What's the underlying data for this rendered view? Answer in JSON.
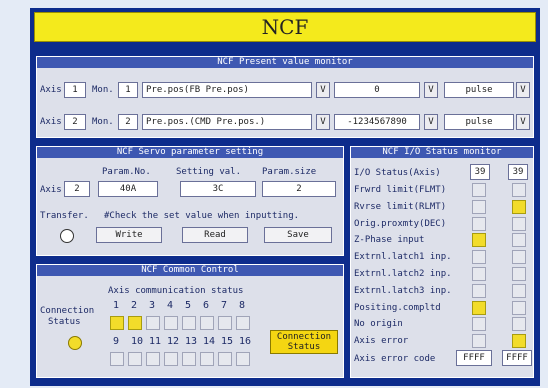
{
  "title": "NCF",
  "present_value": {
    "header": "NCF Present value monitor",
    "rows": [
      {
        "axis_label": "Axis",
        "axis": "1",
        "mon_label": "Mon.",
        "mon": "1",
        "desc": "Pre.pos(FB Pre.pos)",
        "value": "0",
        "unit": "pulse",
        "v": "V"
      },
      {
        "axis_label": "Axis",
        "axis": "2",
        "mon_label": "Mon.",
        "mon": "2",
        "desc": "Pre.pos.(CMD Pre.pos.)",
        "value": "-1234567890",
        "unit": "pulse",
        "v": "V"
      }
    ]
  },
  "servo": {
    "header": "NCF Servo parameter setting",
    "col_param_no": "Param.No.",
    "col_setting": "Setting val.",
    "col_size": "Param.size",
    "axis_label": "Axis",
    "axis": "2",
    "param_no": "40A",
    "setting": "3C",
    "size": "2",
    "transfer_label": "Transfer.",
    "note": "#Check the set value when inputting.",
    "write": "Write",
    "read": "Read",
    "save": "Save"
  },
  "common": {
    "header": "NCF Common Control",
    "axis_comm_label": "Axis communication status",
    "conn_label_1": "Connection",
    "conn_label_2": "Status",
    "row1_nums": [
      "1",
      "2",
      "3",
      "4",
      "5",
      "6",
      "7",
      "8"
    ],
    "row2_nums": [
      "9",
      "10",
      "11",
      "12",
      "13",
      "14",
      "15",
      "16"
    ],
    "row1_on": [
      true,
      true,
      false,
      false,
      false,
      false,
      false,
      false
    ],
    "row2_on": [
      false,
      false,
      false,
      false,
      false,
      false,
      false,
      false
    ],
    "conn_btn_1": "Connection",
    "conn_btn_2": "Status"
  },
  "io": {
    "header": "NCF I/O Status monitor",
    "status_label": "I/O Status(Axis)",
    "axis_a": "39",
    "axis_b": "39",
    "items": [
      {
        "label": "Frwrd limit(FLMT)",
        "a": false,
        "b": false
      },
      {
        "label": "Rvrse limit(RLMT)",
        "a": false,
        "b": true
      },
      {
        "label": "Orig.proxmty(DEC)",
        "a": false,
        "b": false
      },
      {
        "label": "Z-Phase input",
        "a": true,
        "b": false
      },
      {
        "label": "Extrnl.latch1 inp.",
        "a": false,
        "b": false
      },
      {
        "label": "Extrnl.latch2 inp.",
        "a": false,
        "b": false
      },
      {
        "label": "Extrnl.latch3 inp.",
        "a": false,
        "b": false
      },
      {
        "label": "Positing.compltd",
        "a": true,
        "b": false
      },
      {
        "label": "No origin",
        "a": false,
        "b": false
      },
      {
        "label": "Axis error",
        "a": false,
        "b": true
      }
    ],
    "err_label": "Axis error code",
    "err_a": "FFFF",
    "err_b": "FFFF"
  }
}
